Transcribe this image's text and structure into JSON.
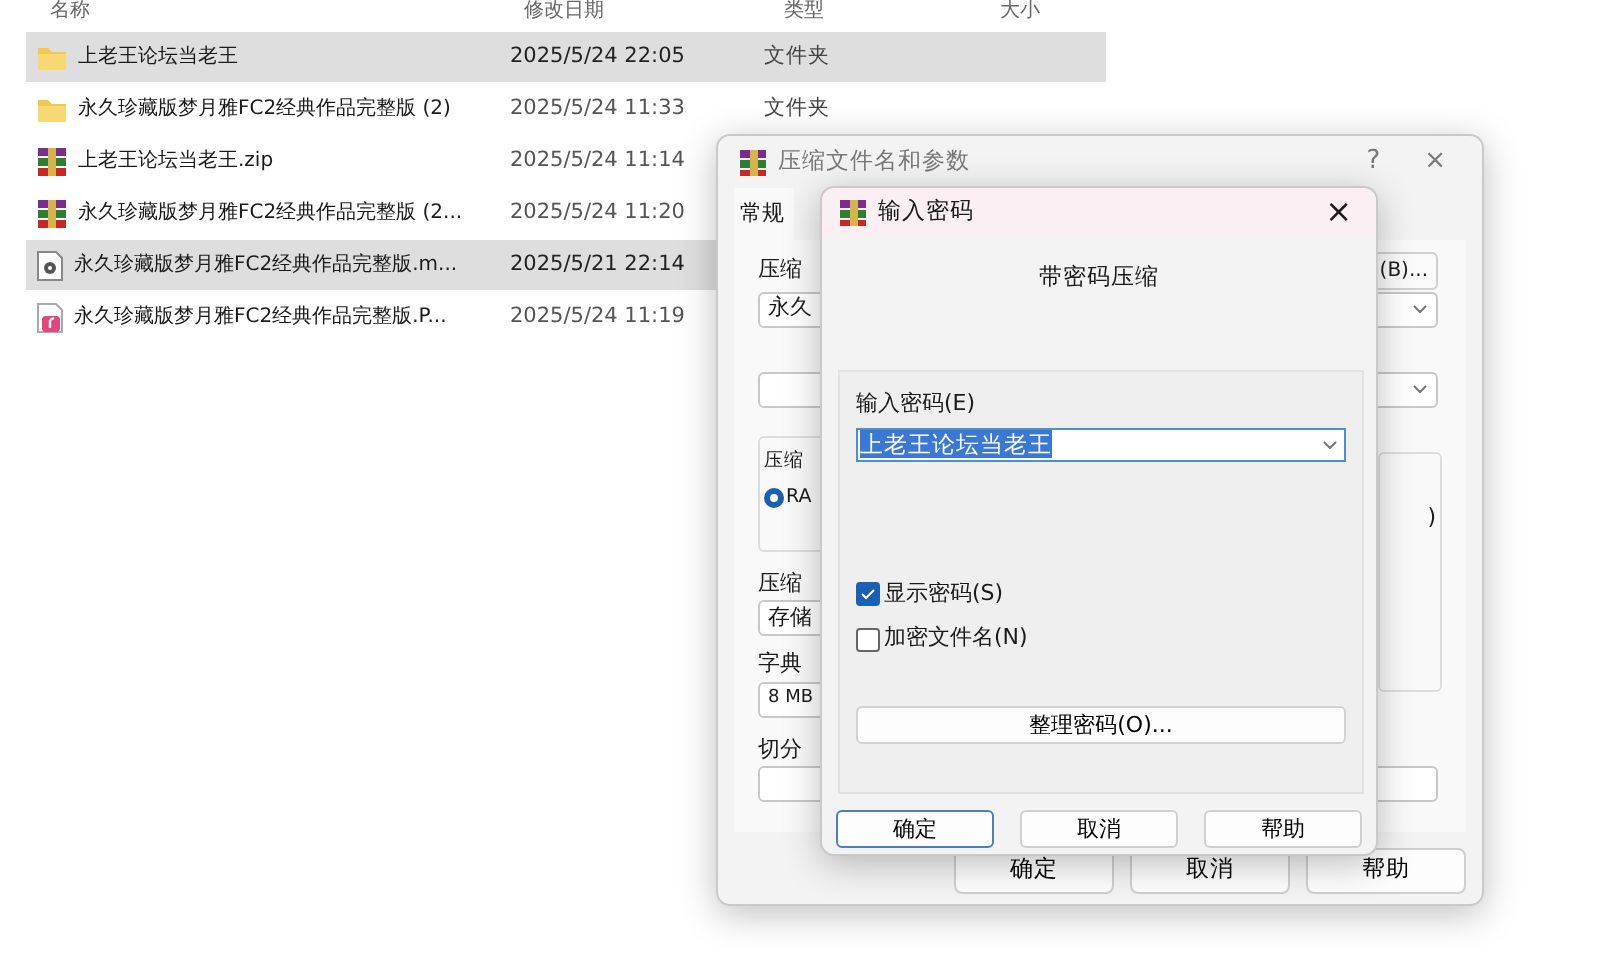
{
  "file_list": {
    "columns": [
      "名称",
      "修改日期",
      "类型",
      "大小"
    ],
    "rows": [
      {
        "kind": "folder",
        "name": "上老王论坛当老王",
        "date": "2025/5/24 22:05",
        "type": "文件夹",
        "selected": true
      },
      {
        "kind": "folder",
        "name": "永久珍藏版梦月雅FC2经典作品完整版 (2)",
        "date": "2025/5/24 11:33",
        "type": "文件夹",
        "selected": false
      },
      {
        "kind": "archive",
        "name": "上老王论坛当老王.zip",
        "date": "2025/5/24 11:14",
        "selected": false
      },
      {
        "kind": "archive",
        "name": "永久珍藏版梦月雅FC2经典作品完整版 (2...",
        "date": "2025/5/24 11:20",
        "selected": false
      },
      {
        "kind": "video",
        "name": "永久珍藏版梦月雅FC2经典作品完整版.m...",
        "date": "2025/5/21 22:14",
        "selected": true
      },
      {
        "kind": "music",
        "name": "永久珍藏版梦月雅FC2经典作品完整版.P...",
        "date": "2025/5/24 11:19",
        "selected": false
      }
    ]
  },
  "back_dialog": {
    "title": "压缩文件名和参数",
    "help": "?",
    "close": "×",
    "tab": "常规",
    "archive_label": "压缩",
    "browse_button": "(B)...",
    "archive_value": "永久",
    "group_label": "压缩",
    "radio_label": "RA",
    "radio_checked": true,
    "side_text": ")",
    "method_label": "压缩",
    "method_value": "存储",
    "dict_label": "字典",
    "dict_value": "8 MB",
    "split_label": "切分",
    "buttons": [
      "确定",
      "取消",
      "帮助"
    ]
  },
  "password_dialog": {
    "title": "输入密码",
    "close": "×",
    "heading": "带密码压缩",
    "password_label": "输入密码(E)",
    "password_value": "上老王论坛当老王",
    "options": [
      {
        "label": "显示密码(S)",
        "checked": true
      },
      {
        "label": "加密文件名(N)",
        "checked": false
      }
    ],
    "organize_button": "整理密码(O)...",
    "buttons": [
      {
        "label": "确定",
        "focused": true
      },
      {
        "label": "取消",
        "focused": false
      },
      {
        "label": "帮助",
        "focused": false
      }
    ]
  }
}
